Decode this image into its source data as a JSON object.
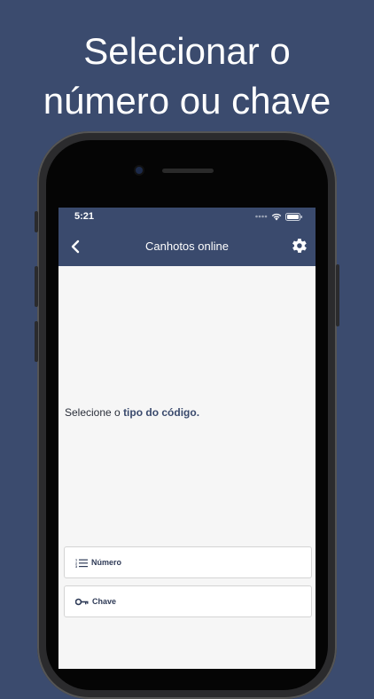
{
  "headline": {
    "line1": "Selecionar o",
    "line2": "número ou chave"
  },
  "statusbar": {
    "time": "5:21",
    "icons": [
      "signal-icon",
      "wifi-icon",
      "battery-icon"
    ]
  },
  "navbar": {
    "title": "Canhotos online",
    "back_icon": "chevron-left-icon",
    "settings_icon": "gear-icon"
  },
  "content": {
    "prompt_prefix": "Selecione o",
    "prompt_emphasis": "tipo do código."
  },
  "options": [
    {
      "label": "Número",
      "icon": "numbered-list-icon"
    },
    {
      "label": "Chave",
      "icon": "key-icon"
    }
  ],
  "colors": {
    "background": "#3b4b6e",
    "navbar": "#3a4a6d",
    "screen": "#f6f6f6"
  }
}
